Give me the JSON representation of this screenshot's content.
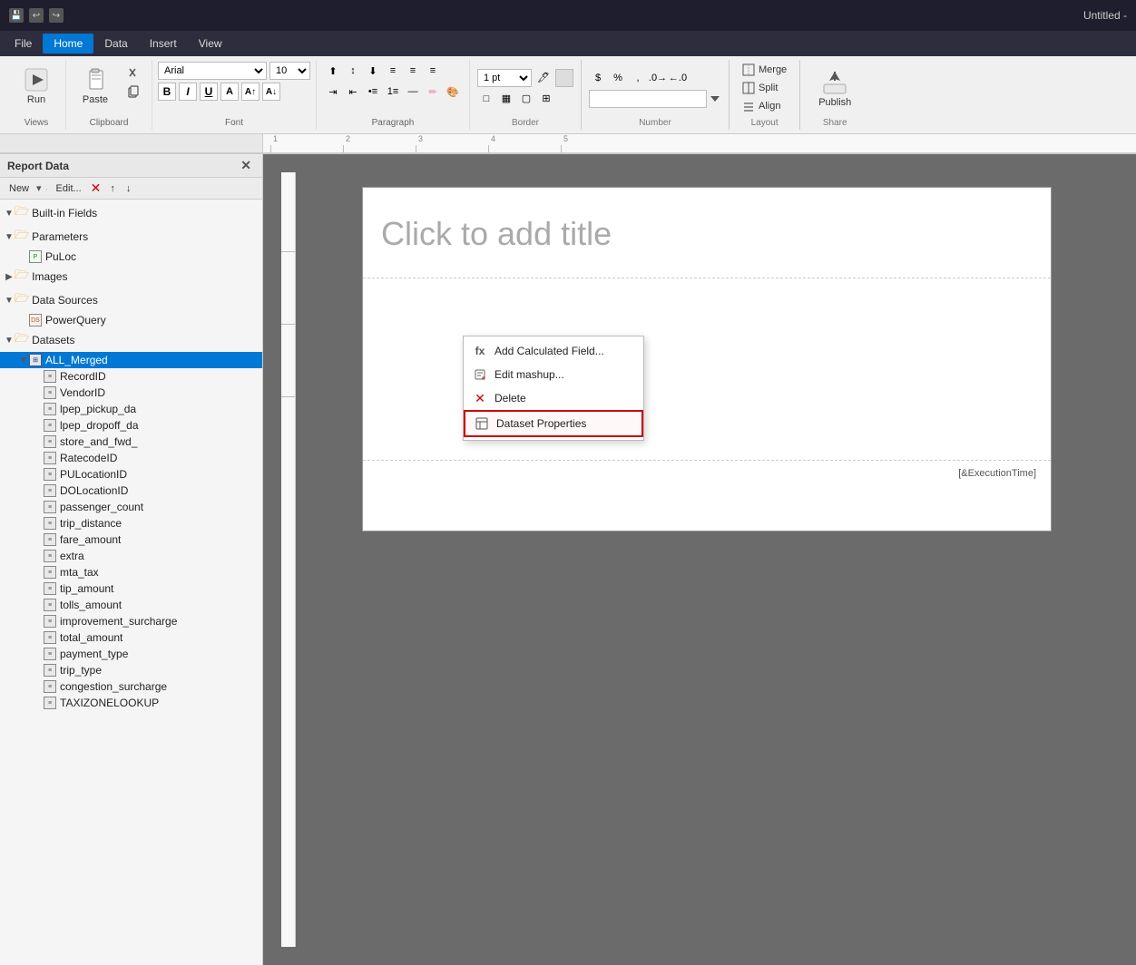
{
  "titleBar": {
    "title": "Untitled -",
    "icons": [
      "save-icon",
      "undo-icon",
      "redo-icon"
    ]
  },
  "menuBar": {
    "items": [
      "File",
      "Home",
      "Data",
      "Insert",
      "View"
    ],
    "activeItem": "Home"
  },
  "ribbon": {
    "groups": [
      {
        "name": "Views",
        "label": "Views",
        "buttons": [
          {
            "label": "Run",
            "icon": "▶"
          }
        ]
      },
      {
        "name": "Clipboard",
        "label": "Clipboard",
        "buttons": [
          {
            "label": "Paste",
            "icon": "📋"
          }
        ]
      },
      {
        "name": "Font",
        "label": "Font",
        "fontName": "Arial",
        "fontSize": "10"
      },
      {
        "name": "Paragraph",
        "label": "Paragraph"
      },
      {
        "name": "Border",
        "label": "Border",
        "borderSize": "1 pt"
      },
      {
        "name": "Number",
        "label": "Number"
      },
      {
        "name": "Layout",
        "label": "Layout",
        "buttons": [
          "Merge",
          "Split",
          "Align"
        ]
      },
      {
        "name": "Share",
        "label": "Share",
        "publishLabel": "Publish"
      }
    ]
  },
  "reportPanel": {
    "title": "Report Data",
    "toolbar": {
      "newLabel": "New",
      "editLabel": "Edit...",
      "deleteIcon": "✕",
      "upIcon": "↑",
      "downIcon": "↓"
    },
    "tree": [
      {
        "id": "built-in-fields",
        "label": "Built-in Fields",
        "type": "folder",
        "level": 0,
        "expanded": true
      },
      {
        "id": "parameters",
        "label": "Parameters",
        "type": "folder",
        "level": 0,
        "expanded": true
      },
      {
        "id": "puloc",
        "label": "PuLoc",
        "type": "parameter",
        "level": 1
      },
      {
        "id": "images",
        "label": "Images",
        "type": "folder",
        "level": 0,
        "expanded": false
      },
      {
        "id": "data-sources",
        "label": "Data Sources",
        "type": "folder",
        "level": 0,
        "expanded": true
      },
      {
        "id": "powerquery",
        "label": "PowerQuery",
        "type": "datasource",
        "level": 1
      },
      {
        "id": "datasets",
        "label": "Datasets",
        "type": "folder",
        "level": 0,
        "expanded": true
      },
      {
        "id": "all-merged",
        "label": "ALL_Merged",
        "type": "dataset",
        "level": 1,
        "selected": true
      },
      {
        "id": "recordid",
        "label": "RecordID",
        "type": "field",
        "level": 2
      },
      {
        "id": "vendorid",
        "label": "VendorID",
        "type": "field",
        "level": 2
      },
      {
        "id": "lpep-pickup",
        "label": "lpep_pickup_da",
        "type": "field",
        "level": 2
      },
      {
        "id": "lpep-dropoff",
        "label": "lpep_dropoff_da",
        "type": "field",
        "level": 2
      },
      {
        "id": "store-fwd",
        "label": "store_and_fwd_",
        "type": "field",
        "level": 2
      },
      {
        "id": "ratecodeid",
        "label": "RatecodeID",
        "type": "field",
        "level": 2
      },
      {
        "id": "pulocationid",
        "label": "PULocationID",
        "type": "field",
        "level": 2
      },
      {
        "id": "dolocationid",
        "label": "DOLocationID",
        "type": "field",
        "level": 2
      },
      {
        "id": "passenger-count",
        "label": "passenger_count",
        "type": "field",
        "level": 2
      },
      {
        "id": "trip-distance",
        "label": "trip_distance",
        "type": "field",
        "level": 2
      },
      {
        "id": "fare-amount",
        "label": "fare_amount",
        "type": "field",
        "level": 2
      },
      {
        "id": "extra",
        "label": "extra",
        "type": "field",
        "level": 2
      },
      {
        "id": "mta-tax",
        "label": "mta_tax",
        "type": "field",
        "level": 2
      },
      {
        "id": "tip-amount",
        "label": "tip_amount",
        "type": "field",
        "level": 2
      },
      {
        "id": "tolls-amount",
        "label": "tolls_amount",
        "type": "field",
        "level": 2
      },
      {
        "id": "improvement-surcharge",
        "label": "improvement_surcharge",
        "type": "field",
        "level": 2
      },
      {
        "id": "total-amount",
        "label": "total_amount",
        "type": "field",
        "level": 2
      },
      {
        "id": "payment-type",
        "label": "payment_type",
        "type": "field",
        "level": 2
      },
      {
        "id": "trip-type",
        "label": "trip_type",
        "type": "field",
        "level": 2
      },
      {
        "id": "congestion-surcharge",
        "label": "congestion_surcharge",
        "type": "field",
        "level": 2
      },
      {
        "id": "taxizonelookup",
        "label": "TAXIZONELOOKUP",
        "type": "field",
        "level": 2
      }
    ]
  },
  "canvas": {
    "titlePlaceholder": "Click to add title",
    "footer": "[&ExecutionTime]"
  },
  "contextMenu": {
    "items": [
      {
        "id": "add-calc",
        "label": "Add Calculated Field...",
        "icon": "fx"
      },
      {
        "id": "edit-mashup",
        "label": "Edit mashup...",
        "icon": "✏"
      },
      {
        "id": "delete",
        "label": "Delete",
        "icon": "✕"
      },
      {
        "id": "dataset-props",
        "label": "Dataset Properties",
        "icon": "☰",
        "highlighted": true
      }
    ]
  },
  "ruler": {
    "ticks": [
      "1",
      "2",
      "3",
      "4",
      "5"
    ]
  }
}
